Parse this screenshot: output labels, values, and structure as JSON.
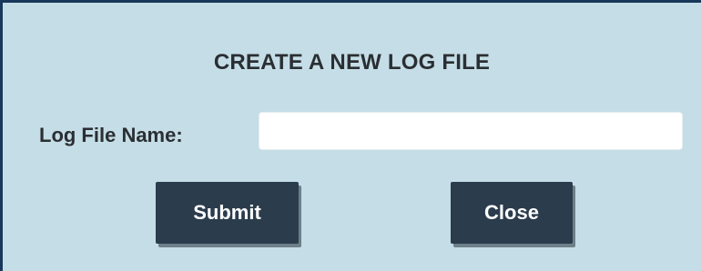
{
  "dialog": {
    "title": "CREATE A NEW LOG FILE",
    "field": {
      "label": "Log File Name:",
      "value": "",
      "placeholder": ""
    },
    "buttons": {
      "submit_label": "Submit",
      "close_label": "Close"
    }
  },
  "colors": {
    "dialog_background": "#c5dde6",
    "dialog_border": "#17385a",
    "button_background": "#2b3c4d",
    "button_text": "#ffffff",
    "text": "#2a2f33"
  }
}
